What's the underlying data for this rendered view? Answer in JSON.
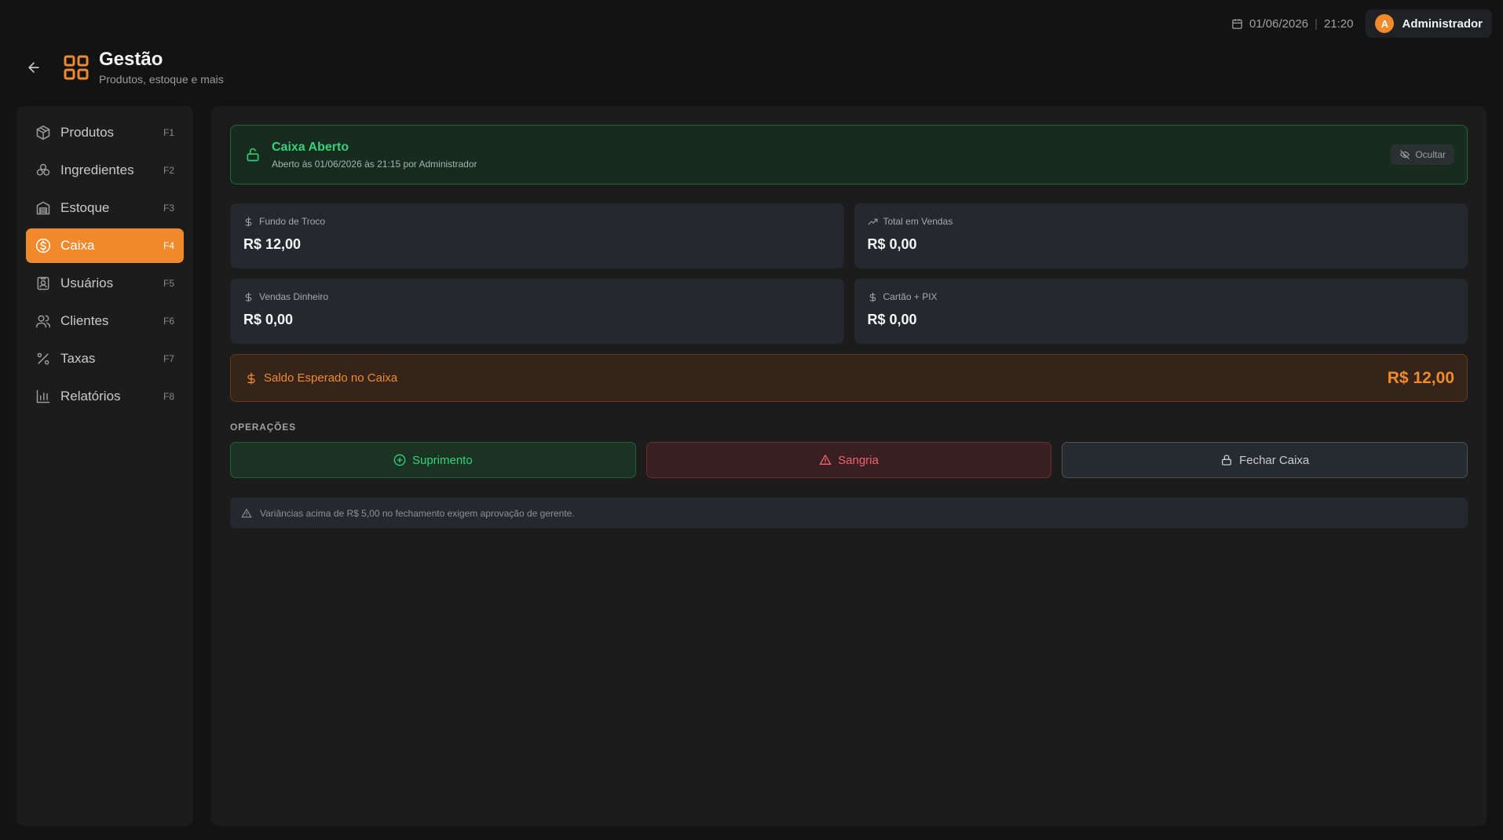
{
  "topbar": {
    "date": "01/06/2026",
    "separator": "|",
    "time": "21:20",
    "user": {
      "initial": "A",
      "name": "Administrador"
    }
  },
  "header": {
    "title": "Gestão",
    "subtitle": "Produtos, estoque e mais"
  },
  "sidebar": {
    "items": [
      {
        "label": "Produtos",
        "key": "F1",
        "icon": "package-icon"
      },
      {
        "label": "Ingredientes",
        "key": "F2",
        "icon": "cherries-icon"
      },
      {
        "label": "Estoque",
        "key": "F3",
        "icon": "warehouse-icon"
      },
      {
        "label": "Caixa",
        "key": "F4",
        "icon": "dollar-circle-icon",
        "active": true
      },
      {
        "label": "Usuários",
        "key": "F5",
        "icon": "user-badge-icon"
      },
      {
        "label": "Clientes",
        "key": "F6",
        "icon": "users-icon"
      },
      {
        "label": "Taxas",
        "key": "F7",
        "icon": "percent-icon"
      },
      {
        "label": "Relatórios",
        "key": "F8",
        "icon": "bar-chart-icon"
      }
    ]
  },
  "status": {
    "title": "Caixa Aberto",
    "subtitle": "Aberto às 01/06/2026 às 21:15 por Administrador",
    "hide_label": "Ocultar"
  },
  "stats": {
    "fundo": {
      "label": "Fundo de Troco",
      "value": "R$ 12,00"
    },
    "total_vendas": {
      "label": "Total em Vendas",
      "value": "R$ 0,00"
    },
    "vendas_dinheiro": {
      "label": "Vendas Dinheiro",
      "value": "R$ 0,00"
    },
    "cartao_pix": {
      "label": "Cartão + PIX",
      "value": "R$ 0,00"
    }
  },
  "balance": {
    "label": "Saldo Esperado no Caixa",
    "value": "R$ 12,00"
  },
  "operations": {
    "title": "OPERAÇÕES",
    "suprimento": "Suprimento",
    "sangria": "Sangria",
    "fechar": "Fechar Caixa"
  },
  "notice": {
    "text": "Variâncias acima de R$ 5,00 no fechamento exigem aprovação de gerente."
  },
  "colors": {
    "accent": "#f08a2c",
    "success": "#36d27a",
    "danger": "#f0626c",
    "background": "#131313"
  }
}
